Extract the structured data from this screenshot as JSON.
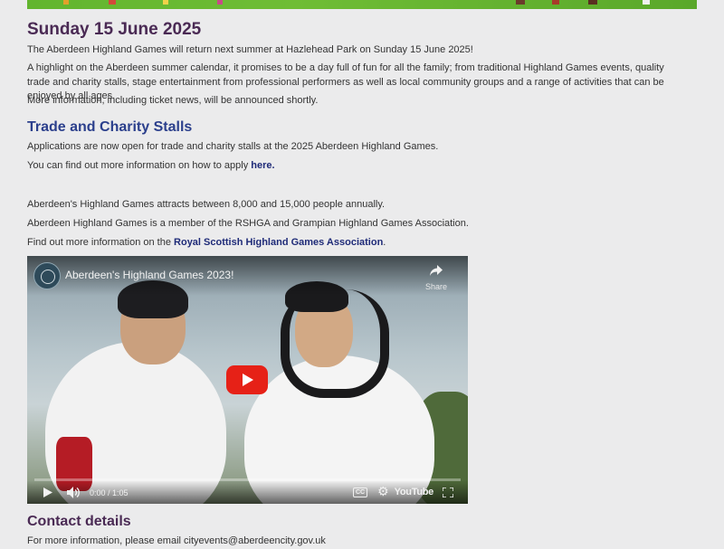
{
  "event": {
    "title": "Sunday 15 June 2025",
    "intro": "The Aberdeen Highland Games will return next summer at Hazlehead Park on Sunday 15 June 2025!",
    "highlight": "A highlight on the Aberdeen summer calendar, it promises to be a day full of fun for all the family; from traditional Highland Games events, quality trade and charity stalls, stage entertainment from professional performers as well as local community groups and a range of activities that can be enjoyed by all ages.",
    "more_info": "More information, including ticket news, will be announced shortly."
  },
  "stalls": {
    "heading": "Trade and Charity Stalls",
    "applications": "Applications are now open for trade and charity stalls at the 2025 Aberdeen Highland Games.",
    "apply_prefix": "You can find out more information on how to apply ",
    "apply_link": "here."
  },
  "facts": {
    "attendance": "Aberdeen's Highland Games attracts between 8,000 and 15,000 people annually.",
    "membership": "Aberdeen Highland Games is a member of the RSHGA and Grampian Highland Games Association.",
    "find_prefix": "Find out more information on the ",
    "find_link": "Royal Scottish Highland Games Association",
    "find_suffix": "."
  },
  "video": {
    "title": "Aberdeen's Highland Games 2023!",
    "share_label": "Share",
    "time": "0:00 / 1:05",
    "cc_label": "CC",
    "brand": "YouTube",
    "progress": 0
  },
  "contact": {
    "heading": "Contact details",
    "text": "For more information, please email cityevents@aberdeencity.gov.uk"
  },
  "colors": {
    "title": "#4a2a54",
    "heading_blue": "#2b3f8c",
    "heading_purple": "#4a2a54",
    "link": "#1f2b78",
    "play": "#e62117"
  }
}
